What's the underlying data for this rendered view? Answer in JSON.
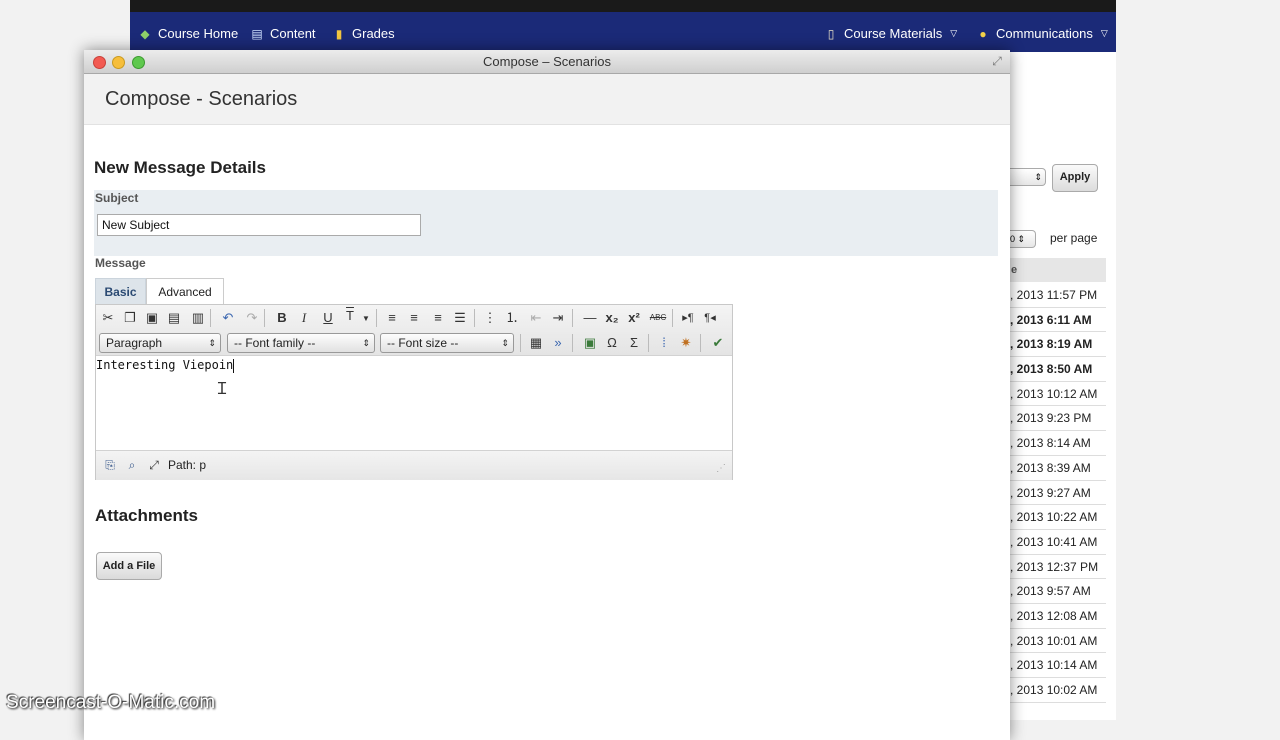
{
  "navbar": {
    "items_left": [
      {
        "label": "Course Home",
        "icon": "home-icon"
      },
      {
        "label": "Content",
        "icon": "book-icon"
      },
      {
        "label": "Grades",
        "icon": "grades-icon"
      }
    ],
    "items_right": [
      {
        "label": "Course Materials",
        "icon": "clipboard-icon"
      },
      {
        "label": "Communications",
        "icon": "chat-icon"
      }
    ],
    "color": "#1b2a78"
  },
  "background_list": {
    "apply_label": "Apply",
    "per_page_label": "per page",
    "header_fragment": "e",
    "rows": [
      {
        "text": ", 2013 11:57 PM",
        "bold": false
      },
      {
        "text": ", 2013 6:11 AM",
        "bold": true
      },
      {
        "text": ", 2013 8:19 AM",
        "bold": true
      },
      {
        "text": ", 2013 8:50 AM",
        "bold": true
      },
      {
        "text": ", 2013 10:12 AM",
        "bold": false
      },
      {
        "text": ", 2013 9:23 PM",
        "bold": false
      },
      {
        "text": ", 2013 8:14 AM",
        "bold": false
      },
      {
        "text": ", 2013 8:39 AM",
        "bold": false
      },
      {
        "text": ", 2013 9:27 AM",
        "bold": false
      },
      {
        "text": ", 2013 10:22 AM",
        "bold": false
      },
      {
        "text": ", 2013 10:41 AM",
        "bold": false
      },
      {
        "text": ", 2013 12:37 PM",
        "bold": false
      },
      {
        "text": ", 2013 9:57 AM",
        "bold": false
      },
      {
        "text": ", 2013 12:08 AM",
        "bold": false
      },
      {
        "text": ", 2013 10:01 AM",
        "bold": false
      },
      {
        "text": ", 2013 10:14 AM",
        "bold": false
      },
      {
        "text": ", 2013 10:02 AM",
        "bold": false
      }
    ]
  },
  "modal": {
    "window_title": "Compose – Scenarios",
    "page_title": "Compose - Scenarios",
    "section_title": "New Message Details",
    "subject_label": "Subject",
    "subject_value": "New Subject",
    "message_label": "Message",
    "tabs": {
      "basic": "Basic",
      "advanced": "Advanced"
    },
    "editor": {
      "format_select": "Paragraph",
      "font_family_select": "-- Font family --",
      "font_size_select": "-- Font size --",
      "content": "Interesting Viepoin",
      "path_label": "Path: p"
    },
    "attachments_title": "Attachments",
    "add_file_label": "Add a File"
  },
  "watermark": "Screencast-O-Matic.com"
}
